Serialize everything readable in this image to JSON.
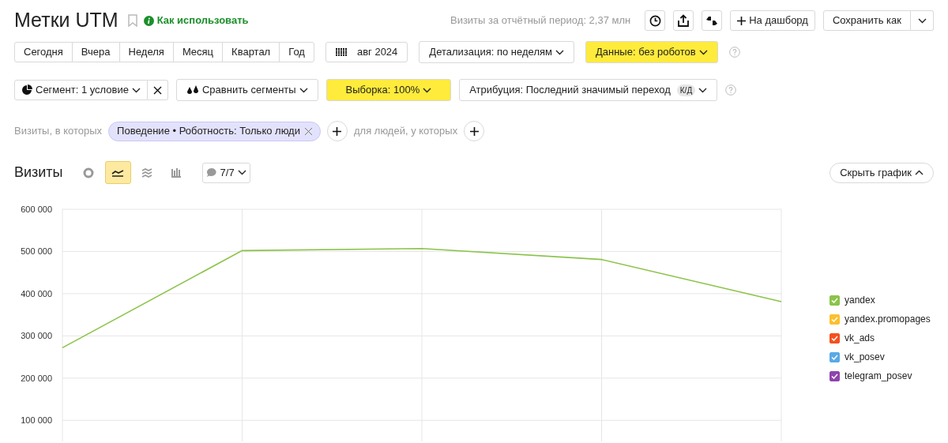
{
  "header": {
    "title": "Метки UTM",
    "help_link": "Как использовать",
    "visits_summary": "Визиты за отчётный период: 2,37 млн",
    "dashboard_button": "На дашборд",
    "save_button": "Сохранить как"
  },
  "periods": [
    "Сегодня",
    "Вчера",
    "Неделя",
    "Месяц",
    "Квартал",
    "Год"
  ],
  "date_button": "авг 2024",
  "filters_row1": [
    {
      "label": "Детализация: по неделям",
      "highlighted": false
    },
    {
      "label": "Данные: без роботов",
      "highlighted": true
    }
  ],
  "segment_button": "Сегмент: 1 условие",
  "filters_row2": [
    {
      "label": "Сравнить сегменты",
      "kind": "compare",
      "highlighted": false
    },
    {
      "label": "Выборка: 100%",
      "kind": "plain",
      "highlighted": true
    },
    {
      "label": "Атрибуция: Последний значимый переход",
      "kind": "attribution",
      "badge": "К/Д",
      "highlighted": false
    }
  ],
  "conditions": {
    "visits_label": "Визиты, в которых",
    "chip": "Поведение • Роботность: Только люди",
    "people_label": "для людей, у которых"
  },
  "chart_header": {
    "title": "Визиты",
    "chart_types": [
      {
        "kind": "pie",
        "selected": false
      },
      {
        "kind": "line",
        "selected": true
      },
      {
        "kind": "area",
        "selected": false
      },
      {
        "kind": "bar",
        "selected": false
      }
    ],
    "notes": "7/7",
    "hide_button": "Скрыть график"
  },
  "chart_data": {
    "type": "line",
    "grid": true,
    "ylim": [
      50000,
      600000
    ],
    "yticks": [
      {
        "value": 100000,
        "label": "100 000"
      },
      {
        "value": 200000,
        "label": "200 000"
      },
      {
        "value": 300000,
        "label": "300 000"
      },
      {
        "value": 400000,
        "label": "400 000"
      },
      {
        "value": 500000,
        "label": "500 000"
      },
      {
        "value": 600000,
        "label": "600 000"
      }
    ],
    "series": [
      {
        "name": "yandex",
        "color": "#8bc34a",
        "values": [
          272000,
          502000,
          507000,
          481000,
          381000
        ]
      }
    ]
  },
  "series_legend": [
    {
      "checked": true
    }
  ],
  "legend": [
    {
      "name": "yandex.promopages",
      "color": "#fbc02d",
      "checked": true
    },
    {
      "name": "vk_ads",
      "color": "#f4511e",
      "checked": true
    },
    {
      "name": "vk_posev",
      "color": "#5aa9e6",
      "checked": true
    },
    {
      "name": "telegram_posev",
      "color": "#8e44ad",
      "checked": true
    }
  ]
}
